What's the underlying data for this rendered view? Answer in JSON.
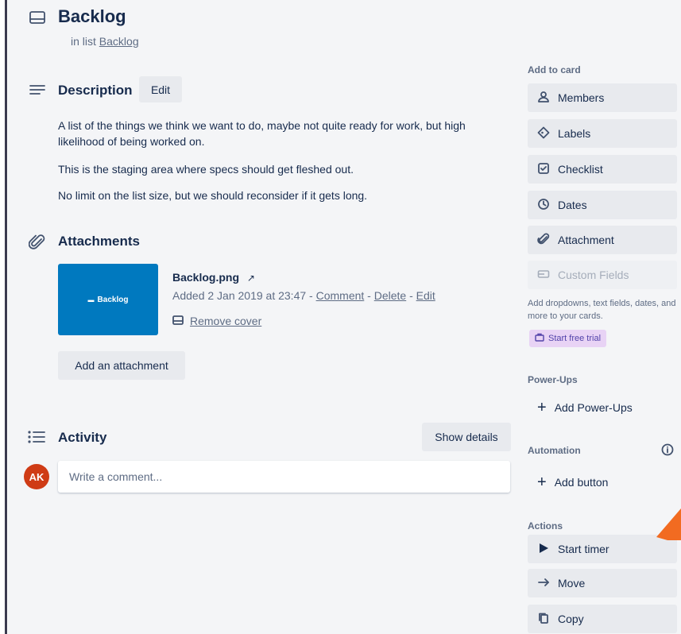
{
  "card": {
    "title": "Backlog",
    "in_list_prefix": "in list",
    "list_name": "Backlog"
  },
  "description": {
    "heading": "Description",
    "edit_label": "Edit",
    "paragraphs": [
      "A list of the things we think we want to do, maybe not quite ready for work, but high likelihood of being worked on.",
      "This is the staging area where specs should get fleshed out.",
      "No limit on the list size, but we should reconsider if it gets long."
    ]
  },
  "attachments": {
    "heading": "Attachments",
    "thumbnail_text": "Backlog",
    "file_name": "Backlog.png",
    "external_glyph": "↗",
    "added_text": "Added 2 Jan 2019 at 23:47 -",
    "comment_label": "Comment",
    "sep": "-",
    "delete_label": "Delete",
    "edit_label": "Edit",
    "remove_cover_label": "Remove cover",
    "add_attachment_label": "Add an attachment"
  },
  "activity": {
    "heading": "Activity",
    "show_details_label": "Show details",
    "avatar_initials": "AK",
    "comment_placeholder": "Write a comment..."
  },
  "sidebar": {
    "add_to_card_heading": "Add to card",
    "members": "Members",
    "labels": "Labels",
    "checklist": "Checklist",
    "dates": "Dates",
    "attachment": "Attachment",
    "custom_fields": "Custom Fields",
    "custom_fields_note": "Add dropdowns, text fields, dates, and more to your cards.",
    "start_free_trial": "Start free trial",
    "powerups_heading": "Power-Ups",
    "add_powerups": "Add Power-Ups",
    "automation_heading": "Automation",
    "add_button": "Add button",
    "actions_heading": "Actions",
    "start_timer": "Start timer",
    "move": "Move",
    "copy": "Copy"
  },
  "colors": {
    "thumbnail_bg": "#0079bf",
    "avatar_bg": "#cf3b15",
    "trial_bg": "#e8d3f5",
    "pointer_arrow": "#f26b21"
  }
}
